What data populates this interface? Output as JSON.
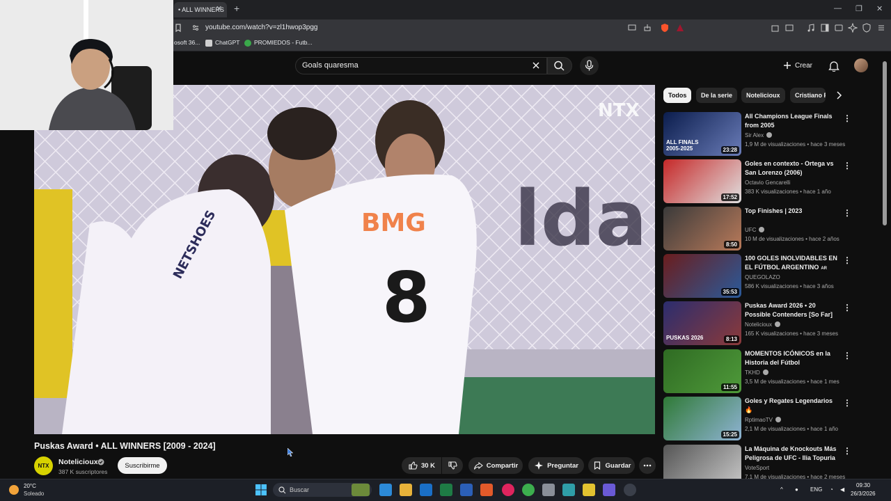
{
  "browser": {
    "tab_title": "• ALL WINNERS",
    "tab_close": "✕",
    "new_tab": "+",
    "url": "youtube.com/watch?v=zl1hwop3pgg",
    "bookmarks": [
      "osoft 36...",
      "ChatGPT",
      "PROMIEDOS - Futb..."
    ]
  },
  "header": {
    "search_query": "Goals quaresma",
    "create_label": "Crear"
  },
  "video": {
    "title": "Puskas Award • ALL WINNERS [2009 - 2024]",
    "watermark": "NTX",
    "shirt_sponsor": "BMG",
    "shirt_number": "8",
    "shirt_brand": "NETSHOES",
    "channel": {
      "name": "Noteliciouх",
      "avatar_text": "NTX",
      "subscribers": "387 K suscriptores",
      "subscribe_label": "Suscribirme"
    },
    "actions": {
      "likes": "30 K",
      "share": "Compartir",
      "ask": "Preguntar",
      "save": "Guardar"
    }
  },
  "chips": [
    "Todos",
    "De la serie",
    "Noteliciouх",
    "Cristiano R"
  ],
  "recommendations": [
    {
      "title": "All Champions League Finals from 2005",
      "channel": "Sir Alex",
      "verified": true,
      "meta": "1,9 M de visualizaciones • hace 3 meses",
      "duration": "23:28",
      "thumb_text": "ALL FINALS 2005-2025",
      "colors": [
        "#0b1d4d",
        "#6a7cb8"
      ]
    },
    {
      "title": "Goles en contexto - Ortega vs San Lorenzo (2006)",
      "channel": "Octavio Gencarelli",
      "verified": false,
      "meta": "383 K visualizaciones • hace 1 año",
      "duration": "17:52",
      "thumb_text": "",
      "colors": [
        "#c62828",
        "#e0e0e0"
      ]
    },
    {
      "title": "Top Finishes | 2023",
      "channel": "UFC",
      "verified": true,
      "meta": "10 M de visualizaciones • hace 2 años",
      "duration": "8:50",
      "thumb_text": "",
      "colors": [
        "#3a3a3a",
        "#b97a5a"
      ]
    },
    {
      "title": "100 GOLES INOLVIDABLES EN EL FÚTBOL ARGENTINO",
      "title_suffix": "AR",
      "channel": "QUEGOLAZO",
      "verified": false,
      "meta": "586 K visualizaciones • hace 3 años",
      "duration": "35:53",
      "thumb_text": "",
      "colors": [
        "#6b1d1d",
        "#2a5a9a"
      ]
    },
    {
      "title": "Puskas Award 2026 • 20 Possible Contenders [So Far]",
      "channel": "Noteliciouх",
      "verified": true,
      "meta": "165 K visualizaciones • hace 3 meses",
      "duration": "8:13",
      "thumb_text": "PUSKAS 2026",
      "colors": [
        "#2b2d6e",
        "#8c3a3a"
      ]
    },
    {
      "title": "MOMENTOS ICÓNICOS en la Historia del Fútbol",
      "channel": "TKHD",
      "verified": true,
      "meta": "3,5 M de visualizaciones • hace 1 mes",
      "duration": "11:55",
      "thumb_text": "",
      "colors": [
        "#2f6b23",
        "#4f9a3a"
      ]
    },
    {
      "title": "Goles y Regates Legendarios",
      "title_emoji": "🔥",
      "channel": "RptimaoTV",
      "verified": true,
      "meta": "2,1 M de visualizaciones • hace 1 año",
      "duration": "15:25",
      "thumb_text": "",
      "colors": [
        "#2f7a36",
        "#8fb3d4"
      ]
    },
    {
      "title": "La Máquina de Knockouts Más Peligrosa de UFC - Ilia Topuria",
      "channel": "VoteSport",
      "verified": false,
      "meta": "7,1 M de visualizaciones • hace 2 meses",
      "duration": "",
      "thumb_text": "",
      "colors": [
        "#555",
        "#c9c9c9"
      ]
    }
  ],
  "taskbar": {
    "weather_temp": "20°C",
    "weather_desc": "Soleado",
    "search_placeholder": "Buscar",
    "language": "ENG",
    "time": "09:30",
    "date": "26/3/2026"
  }
}
